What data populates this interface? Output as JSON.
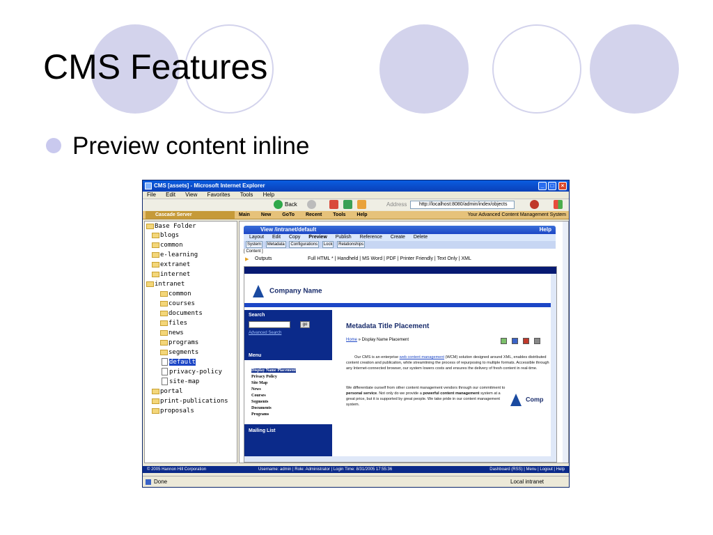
{
  "slide": {
    "title": "CMS Features",
    "bullet": "Preview content inline"
  },
  "colors": {
    "circle": "#d3d3ec",
    "ie_blue": "#0a3fb8",
    "cms_gold": "#e6c27a",
    "site_navy": "#0b2a8a"
  },
  "browser": {
    "title": "CMS [assets] - Microsoft Internet Explorer",
    "menu": [
      "File",
      "Edit",
      "View",
      "Favorites",
      "Tools",
      "Help"
    ],
    "back_label": "Back",
    "address_label": "Address",
    "address_value": "http://localhost:8080/admin/index/objects",
    "status_text": "Done",
    "zone_text": "Local intranet"
  },
  "cms": {
    "logo": "Cascade Server",
    "nav": [
      "Main",
      "New",
      "GoTo",
      "Recent",
      "Tools",
      "Help"
    ],
    "tagline": "Your Advanced Content Management System",
    "tree": [
      {
        "label": "Base Folder",
        "icon": "folder-icon"
      },
      {
        "label": "blogs",
        "icon": "folder-icon"
      },
      {
        "label": "common",
        "icon": "folder-icon"
      },
      {
        "label": "e-learning",
        "icon": "folder-icon"
      },
      {
        "label": "extranet",
        "icon": "folder-icon"
      },
      {
        "label": "internet",
        "icon": "folder-icon"
      },
      {
        "label": "intranet",
        "icon": "folder-icon"
      },
      {
        "label": "common",
        "icon": "folder-icon"
      },
      {
        "label": "courses",
        "icon": "folder-icon"
      },
      {
        "label": "documents",
        "icon": "folder-icon"
      },
      {
        "label": "files",
        "icon": "folder-icon"
      },
      {
        "label": "news",
        "icon": "folder-icon"
      },
      {
        "label": "programs",
        "icon": "folder-icon"
      },
      {
        "label": "segments",
        "icon": "folder-icon"
      },
      {
        "label": "default",
        "icon": "page-icon"
      },
      {
        "label": "privacy-policy",
        "icon": "page-icon"
      },
      {
        "label": "site-map",
        "icon": "page-icon"
      },
      {
        "label": "portal",
        "icon": "folder-icon"
      },
      {
        "label": "print-publications",
        "icon": "folder-icon"
      },
      {
        "label": "proposals",
        "icon": "folder-icon"
      }
    ],
    "view": {
      "title": "View /intranet/default",
      "help": "Help",
      "menu": [
        "Layout",
        "Edit",
        "Copy",
        "Preview",
        "Publish",
        "Reference",
        "Create",
        "Delete"
      ],
      "drops": [
        "System",
        "Metadata",
        "Configurations",
        "Lock",
        "Relationships"
      ],
      "content_tab": "[ Content ]",
      "outputs_label": "Outputs",
      "outputs_list": "Full HTML * | Handheld | MS Word | PDF | Printer Friendly | Text Only | XML"
    },
    "footer": {
      "copyright": "© 2005 Hannon Hill Corporation",
      "session": "Username: admin  |  Role: Administrator  |  Login Time: 8/31/2005  17:55:36",
      "links": "Dashboard (RSS)  |  Menu  |  Logout  |  Help"
    }
  },
  "site_preview": {
    "company": "Company Name",
    "search_heading": "Search",
    "go_label": "go",
    "advanced_search": "Advanced Search",
    "menu_heading": "Menu",
    "menu_items": [
      "Display Name Placement",
      "Privacy Policy",
      "Site Map",
      "News",
      "Courses",
      "Segments",
      "Documents",
      "Programs"
    ],
    "mailing_heading": "Mailing List",
    "page_title": "Metadata Title Placement",
    "crumb_home": "Home",
    "crumb_rest": " » Display Name Placement",
    "para1_a": "Our CMS is an enterprise ",
    "para1_link": "web content management",
    "para1_b": " (WCM) solution designed around XML, enables distributed content creation and publication, while streamlining the process of repurposing to multiple formats. Accessible through any Internet-connected browser, our system lowers costs and ensures the delivery of fresh content in real-time.",
    "para2_a": "We differentiate ourself from other content management vendors through our commitment to ",
    "para2_b1": "personal service",
    "para2_c": ". Not only do we provide a ",
    "para2_b2": "powerful content management",
    "para2_d": " system at a great price, but it is supported by great people. We take pride in our content management system.",
    "company_short": "Comp"
  }
}
